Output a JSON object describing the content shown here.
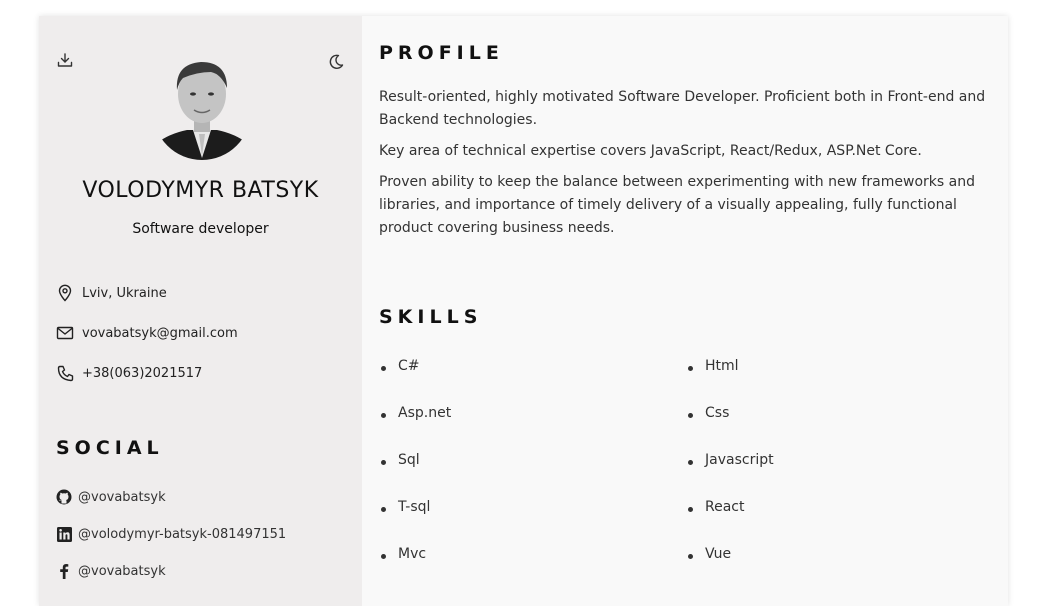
{
  "sidebar": {
    "name": "VOLODYMYR BATSYK",
    "role": "Software developer",
    "contacts": {
      "location": "Lviv, Ukraine",
      "email": "vovabatsyk@gmail.com",
      "phone": "+38(063)2021517"
    },
    "social_title": "SOCIAL",
    "social": {
      "github": "@vovabatsyk",
      "linkedin": "@volodymyr-batsyk-081497151",
      "facebook": "@vovabatsyk"
    },
    "icons": [
      "download-icon",
      "moon-icon",
      "location-pin-icon",
      "mail-icon",
      "phone-icon",
      "github-icon",
      "linkedin-icon",
      "facebook-icon"
    ]
  },
  "main": {
    "profile_title": "PROFILE",
    "profile_paragraphs": [
      "Result-oriented, highly motivated Software Developer. Proficient both in Front-end and Backend technologies.",
      "Key area of technical expertise covers JavaScript, React/Redux, ASP.Net Core.",
      "Proven ability to keep the balance between experimenting with new frameworks and libraries, and importance of timely delivery of a visually appealing, fully functional product covering business needs."
    ],
    "skills_title": "SKILLS",
    "skills": [
      "C#",
      "Html",
      "Asp.net",
      "Css",
      "Sql",
      "Javascript",
      "T-sql",
      "React",
      "Mvc",
      "Vue"
    ]
  },
  "colors": {
    "sidebar_bg": "#efeded",
    "main_bg": "#f9f9f9",
    "text": "#111111"
  }
}
